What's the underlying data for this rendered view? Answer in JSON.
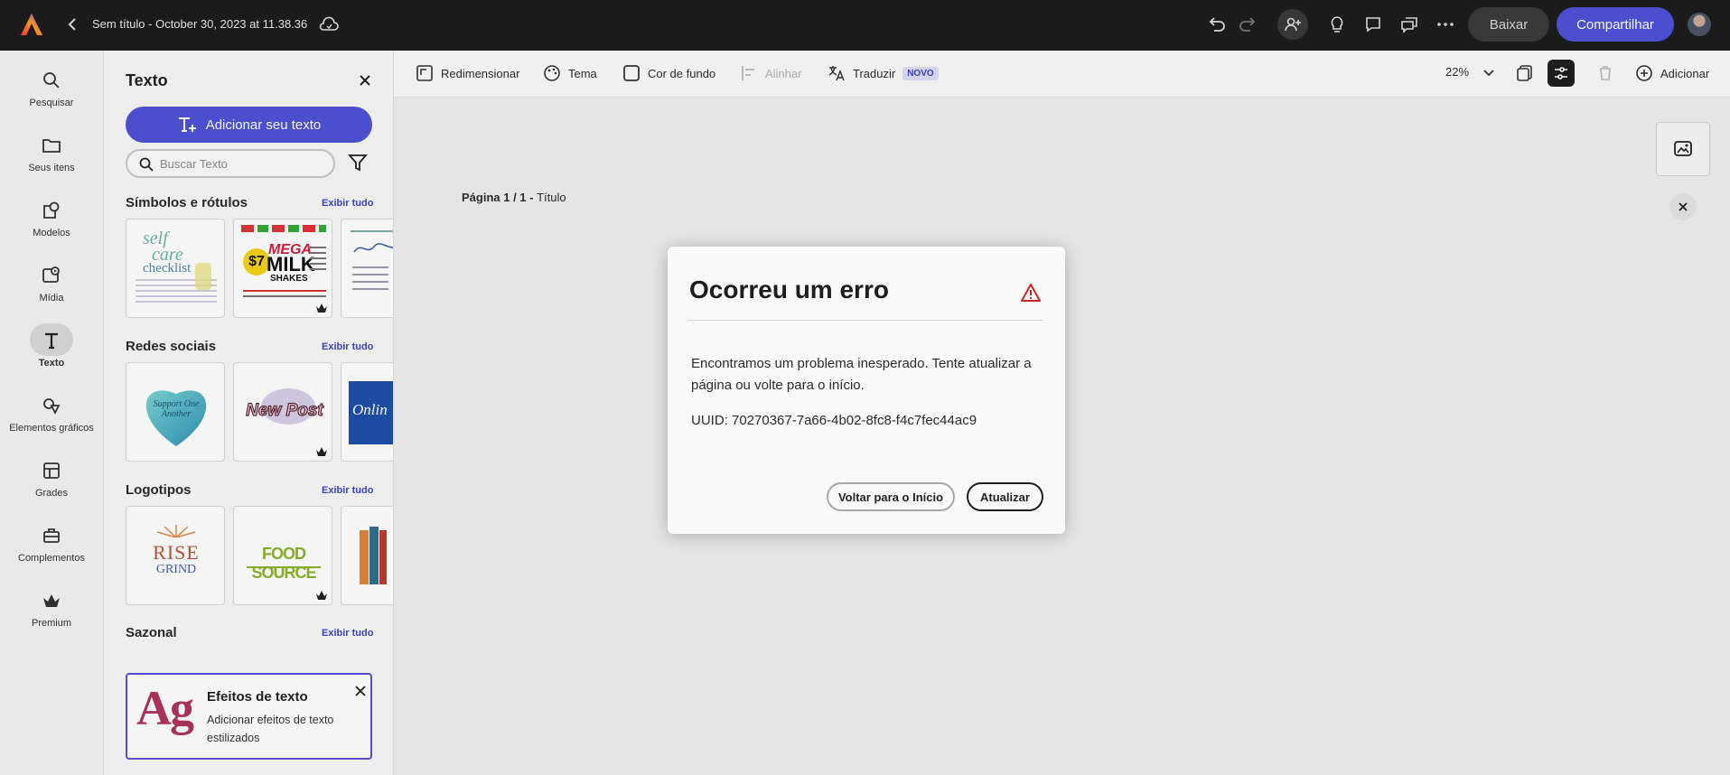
{
  "topbar": {
    "doc_title": "Sem título - October 30, 2023 at 11.38.36",
    "download_label": "Baixar",
    "share_label": "Compartilhar"
  },
  "rail": {
    "items": [
      {
        "label": "Pesquisar",
        "icon": "search-icon"
      },
      {
        "label": "Seus itens",
        "icon": "folder-icon"
      },
      {
        "label": "Modelos",
        "icon": "templates-icon"
      },
      {
        "label": "Mídia",
        "icon": "media-icon"
      },
      {
        "label": "Texto",
        "icon": "text-icon"
      },
      {
        "label": "Elementos gráficos",
        "icon": "shapes-icon"
      },
      {
        "label": "Grades",
        "icon": "grid-icon"
      },
      {
        "label": "Complementos",
        "icon": "addons-icon"
      },
      {
        "label": "Premium",
        "icon": "crown-icon"
      }
    ],
    "active": "Texto"
  },
  "panel": {
    "title": "Texto",
    "add_text_label": "Adicionar seu texto",
    "search_placeholder": "Buscar Texto",
    "sections": [
      {
        "title": "Símbolos e rótulos",
        "link": "Exibir tudo"
      },
      {
        "title": "Redes sociais",
        "link": "Exibir tudo"
      },
      {
        "title": "Logotipos",
        "link": "Exibir tudo"
      },
      {
        "title": "Sazonal",
        "link": "Exibir tudo"
      }
    ],
    "thumbs": {
      "t1_line1": "self",
      "t1_line2": "care",
      "t1_line3": "checklist",
      "t2_price": "$7",
      "t2_line1": "MEGA",
      "t2_line2": "MILK",
      "t2_line3": "SHAKES",
      "t4_text": "Support One Another",
      "t5_text": "New Post",
      "t6_text": "Onlin",
      "t7_line1": "RISE",
      "t7_line2": "GRIND",
      "t8_text": "FOOD SOURCE"
    },
    "promo": {
      "title": "Efeitos de texto",
      "desc": "Adicionar efeitos de texto estilizados",
      "glyph": "Ag"
    }
  },
  "toolbar": {
    "resize": "Redimensionar",
    "theme": "Tema",
    "bg_color": "Cor de fundo",
    "align": "Alinhar",
    "translate": "Traduzir",
    "new_badge": "NOVO",
    "zoom": "22%",
    "add": "Adicionar"
  },
  "canvas": {
    "page_prefix": "Página 1 / 1 - ",
    "page_title": "Título"
  },
  "modal": {
    "title": "Ocorreu um erro",
    "body": "Encontramos um problema inesperado. Tente atualizar a página ou volte para o início.",
    "uuid": "UUID: 70270367-7a66-4b02-8fc8-f4c7fec44ac9",
    "back_label": "Voltar para o Início",
    "refresh_label": "Atualizar"
  },
  "colors": {
    "accent": "#4f52d6",
    "topbar": "#1d1d1d",
    "warning": "#c9252d"
  }
}
